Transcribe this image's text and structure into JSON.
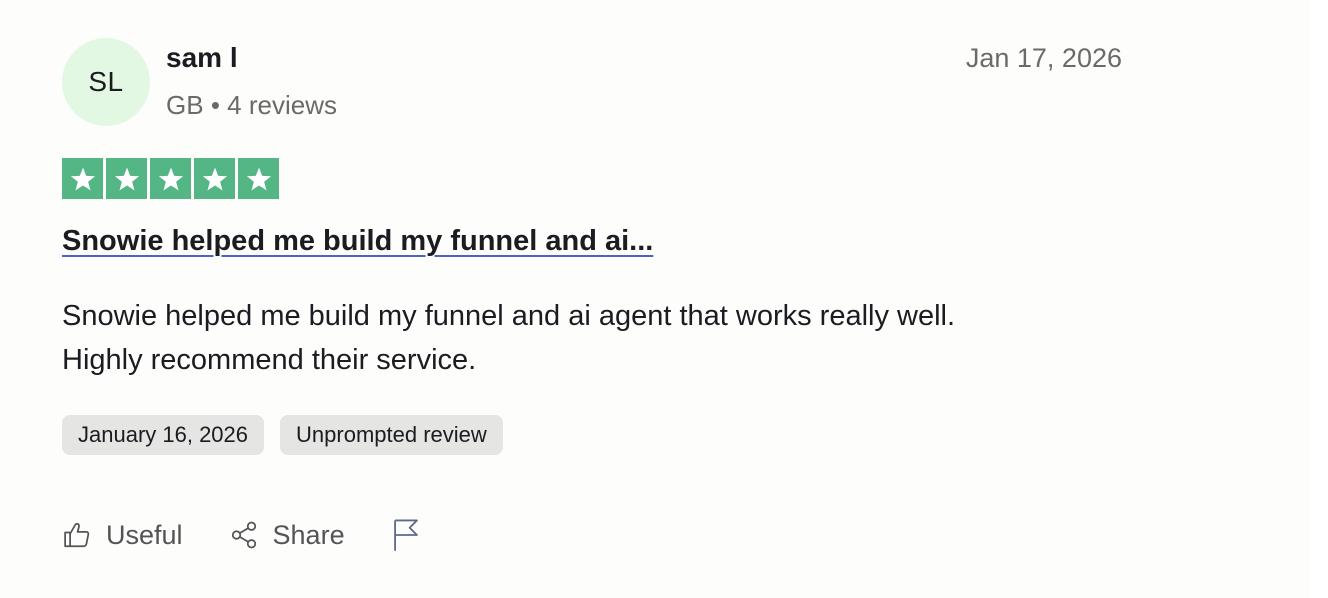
{
  "reviewer": {
    "initials": "SL",
    "name": "sam l",
    "country": "GB",
    "separator": "•",
    "review_count": "4 reviews"
  },
  "review": {
    "published_date": "Jan 17, 2026",
    "rating": 5,
    "rating_max": 5,
    "star_color": "#55b685",
    "title": "Snowie helped me build my funnel and ai...",
    "body_lines": [
      "Snowie helped me build my funnel and ai agent that works really well.",
      "Highly recommend their service."
    ],
    "tags": [
      "January 16, 2026",
      "Unprompted review"
    ]
  },
  "actions": {
    "useful_label": "Useful",
    "useful_icon": "thumbs-up-icon",
    "share_label": "Share",
    "share_icon": "share-icon",
    "report_icon": "flag-icon"
  },
  "colors": {
    "avatar_bg": "#e2f8e2",
    "title_underline": "#4c62c6",
    "tag_bg": "#e5e5e3",
    "muted_text": "#696a6a"
  }
}
